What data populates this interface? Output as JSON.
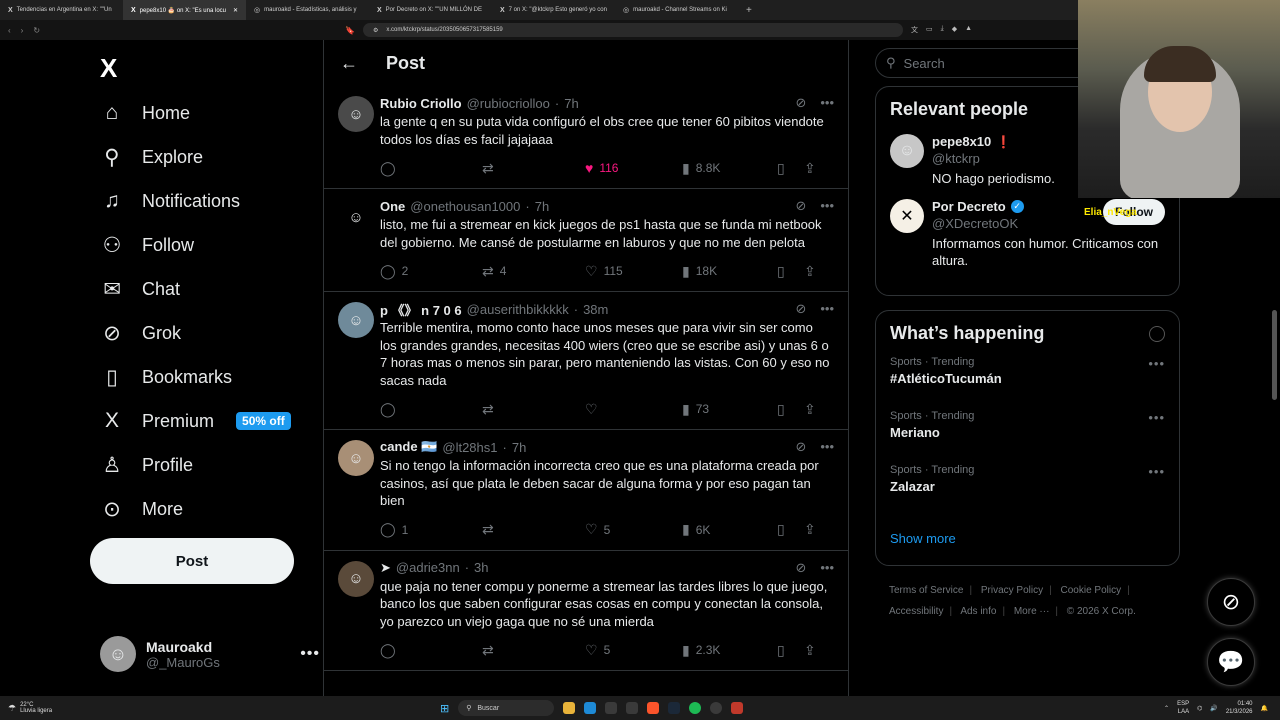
{
  "browser": {
    "tabs": [
      {
        "icon": "X",
        "title": "Tendencias en Argentina en X: \"\"Un"
      },
      {
        "icon": "X",
        "title": "pepe8x10 🎂 on X: \"Es una locu"
      },
      {
        "icon": "◎",
        "title": "mauroakd - Estadísticas, análisis y"
      },
      {
        "icon": "X",
        "title": "Por Decreto on X: \"\"UN MILLÓN DE"
      },
      {
        "icon": "X",
        "title": "7 on X: \"@ktckrp Esto generó yo con"
      },
      {
        "icon": "◎",
        "title": "mauroakd - Channel Streams on Ki"
      }
    ],
    "url": "x.com/ktckrp/status/2035050657317585159"
  },
  "nav": {
    "items": [
      {
        "label": "Home",
        "icon": "⌂"
      },
      {
        "label": "Explore",
        "icon": "⚲"
      },
      {
        "label": "Notifications",
        "icon": "🔔"
      },
      {
        "label": "Follow",
        "icon": "👤"
      },
      {
        "label": "Chat",
        "icon": "✉"
      },
      {
        "label": "Grok",
        "icon": "⊘"
      },
      {
        "label": "Bookmarks",
        "icon": "🔖"
      },
      {
        "label": "Premium",
        "icon": "X",
        "badge": "50% off"
      },
      {
        "label": "Profile",
        "icon": "👤"
      },
      {
        "label": "More",
        "icon": "⋯"
      }
    ],
    "post_label": "Post",
    "account": {
      "name": "Mauroakd",
      "handle": "@_MauroGs"
    }
  },
  "header": {
    "title": "Post"
  },
  "tweets": [
    {
      "name": "Rubio Criollo",
      "handle": "@rubiocriolloo",
      "time": "7h",
      "avatar_color": "#4a4a4a",
      "text": "la gente q en su puta vida configuró el obs cree que tener 60 pibitos viendote todos los días es facil jajajaaa",
      "replies": "",
      "reposts": "",
      "likes": "116",
      "views": "8.8K",
      "liked": true
    },
    {
      "name": "One",
      "handle": "@onethousan1000",
      "time": "7h",
      "avatar_color": "#000000",
      "text": "listo, me fui a stremear en kick juegos de ps1 hasta que se funda mi netbook del gobierno. Me cansé de postularme en laburos y que no me den pelota",
      "replies": "2",
      "reposts": "4",
      "likes": "115",
      "views": "18K",
      "liked": false
    },
    {
      "name": "p 《》 n 7 0 6",
      "handle": "@auserithbikkkkk",
      "time": "38m",
      "avatar_color": "#6f8a9a",
      "text": "Terrible mentira, momo conto hace unos meses que para vivir sin ser como los grandes grandes, necesitas 400 wiers (creo que se escribe asi) y unas 6 o 7 horas mas o menos sin parar, pero manteniendo las vistas. Con 60 y eso no sacas nada",
      "replies": "",
      "reposts": "",
      "likes": "",
      "views": "73",
      "liked": false
    },
    {
      "name": "cande 🇦🇷",
      "handle": "@lt28hs1",
      "time": "7h",
      "avatar_color": "#a88f76",
      "text": "Si no tengo la información incorrecta creo que es una plataforma creada por casinos, así que plata le deben sacar de alguna forma y por eso pagan tan bien",
      "replies": "1",
      "reposts": "",
      "likes": "5",
      "views": "6K",
      "liked": false
    },
    {
      "name": "➤",
      "handle": "@adrie3nn",
      "time": "3h",
      "avatar_color": "#5a4a3a",
      "text": "que paja no tener compu y ponerme a stremear las tardes libres lo que juego, banco los que saben configurar esas cosas en compu y conectan la consola, yo parezco un viejo gaga que no sé una mierda",
      "replies": "",
      "reposts": "",
      "likes": "5",
      "views": "2.3K",
      "liked": false
    }
  ],
  "search": {
    "placeholder": "Search"
  },
  "relevant": {
    "title": "Relevant people",
    "people": [
      {
        "name": "pepe8x10",
        "handle": "@ktckrp",
        "bio": "NO hago periodismo.",
        "verified": false,
        "mark": "❗"
      },
      {
        "name": "Por Decreto",
        "handle": "@XDecretoOK",
        "bio": "Informamos con humor. Criticamos con altura.",
        "verified": true,
        "follow_label": "Follow"
      }
    ]
  },
  "happening": {
    "title": "What’s happening",
    "trends": [
      {
        "category": "Sports · Trending",
        "name": "#AtléticoTucumán"
      },
      {
        "category": "Sports · Trending",
        "name": "Meriano"
      },
      {
        "category": "Sports · Trending",
        "name": "Zalazar"
      }
    ],
    "show_more": "Show more"
  },
  "footer": {
    "links": [
      "Terms of Service",
      "Privacy Policy",
      "Cookie Policy",
      "Accessibility",
      "Ads info",
      "More ···",
      "© 2026 X Corp."
    ]
  },
  "overlay": {
    "label": "Elia_nVega"
  },
  "taskbar": {
    "weather_temp": "22°C",
    "weather_desc": "Lluvia ligera",
    "search_label": "Buscar",
    "lang": "ESP",
    "layout": "LAA",
    "time": "01:40",
    "date": "21/3/2026"
  }
}
